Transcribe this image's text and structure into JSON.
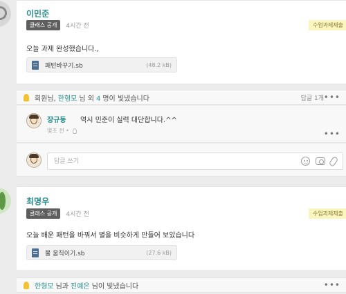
{
  "post1": {
    "author": "이민준",
    "badge": "클래스 공개",
    "time": "4시간 전",
    "tag": "수업과제제출",
    "body": "오늘 과제 완성했습니다.,",
    "file": {
      "name": "패턴바꾸기.sb",
      "size": "(48.2 kB)"
    },
    "likes": {
      "prefix": "회원님,",
      "name": "한형모",
      "middle": "님 외",
      "count": "4",
      "suffix": "명이 빛냈습니다"
    },
    "reply_count": "답글 1개",
    "comment": {
      "author": "장규동",
      "text": "역시 민준이 실력 대단합니다.^^",
      "time": "몇초 전 •"
    }
  },
  "write": {
    "placeholder": "답글 쓰기"
  },
  "post2": {
    "author": "최명우",
    "badge": "클래스 공개",
    "time": "4시간 전",
    "tag": "수업과제제출",
    "body": "오늘 배운 패턴을 바꿔서 별을 비슷하게 만들어 보았습니다",
    "file": {
      "name": "물 움직이기.sb",
      "size": "(27.6 kB)"
    },
    "likes": {
      "name1": "한형모",
      "middle": "님과",
      "name2": "진예은",
      "suffix": "님이 빛냈습니다"
    }
  },
  "icons": {
    "more": "more-dots-icon",
    "bulb": "lightbulb-icon",
    "file": "file-icon",
    "emoji": "emoji-icon",
    "camera": "camera-icon",
    "attach": "paperclip-icon"
  },
  "colors": {
    "accent": "#2a8f8f",
    "tag_bg": "#fbf6bf",
    "badge_bg": "#5e5e5e",
    "bulb": "#f1c232"
  }
}
